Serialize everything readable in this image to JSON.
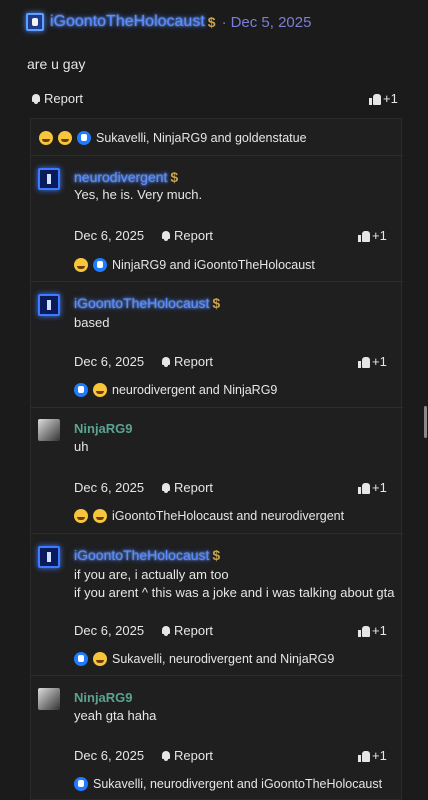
{
  "post": {
    "author": "iGoontoTheHolocaust",
    "badge": "$",
    "separator": "·",
    "date": "Dec 5, 2025",
    "body": "are u gay",
    "report_label": "Report",
    "like_count": "+1",
    "reactions_text": "Sukavelli, NinjaRG9 and goldenstatue"
  },
  "comments": [
    {
      "author": "neurodivergent",
      "badge": "$",
      "lines": [
        "Yes, he is. Very much."
      ],
      "date": "Dec 6, 2025",
      "report_label": "Report",
      "like_count": "+1",
      "reactions_text": "NinjaRG9 and iGoontoTheHolocaust"
    },
    {
      "author": "iGoontoTheHolocaust",
      "badge": "$",
      "lines": [
        "based"
      ],
      "date": "Dec 6, 2025",
      "report_label": "Report",
      "like_count": "+1",
      "reactions_text": "neurodivergent and NinjaRG9"
    },
    {
      "author": "NinjaRG9",
      "lines": [
        "uh"
      ],
      "date": "Dec 6, 2025",
      "report_label": "Report",
      "like_count": "+1",
      "reactions_text": "iGoontoTheHolocaust and neurodivergent"
    },
    {
      "author": "iGoontoTheHolocaust",
      "badge": "$",
      "lines": [
        "if you are, i actually am too",
        "if you arent ^ this was a joke and i was talking about gta"
      ],
      "date": "Dec 6, 2025",
      "report_label": "Report",
      "like_count": "+1",
      "reactions_text": "Sukavelli, neurodivergent and NinjaRG9"
    },
    {
      "author": "NinjaRG9",
      "lines": [
        "yeah gta haha"
      ],
      "date": "Dec 6, 2025",
      "report_label": "Report",
      "like_count": "+1",
      "reactions_text": "Sukavelli, neurodivergent and iGoontoTheHolocaust"
    }
  ],
  "colors": {
    "background": "#1b1b1c",
    "username_glow": "#5b8dff",
    "username_green": "#5aa38f",
    "date_accent": "#7a7ed6",
    "badge_gold": "#c8a34a",
    "like_blue": "#1f7bff"
  },
  "icons": [
    "avatar",
    "bell-icon",
    "thumbs-up-icon",
    "like-reaction-icon",
    "laugh-reaction-icon",
    "shock-reaction-icon",
    "confused-reaction-icon",
    "nerd-reaction-icon",
    "wink-reaction-icon"
  ]
}
